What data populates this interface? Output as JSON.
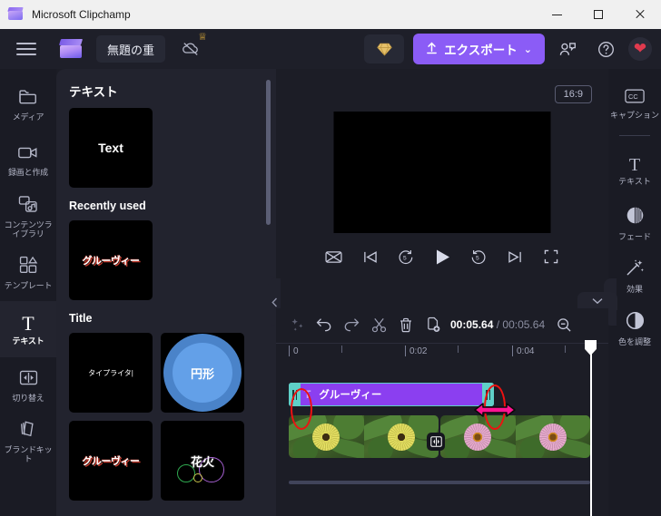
{
  "window": {
    "title": "Microsoft Clipchamp",
    "app_icon": "clapperboard-icon",
    "minimize": "—",
    "maximize": "□",
    "close": "✕"
  },
  "toolbar": {
    "menu_icon": "hamburger-menu-icon",
    "brand_icon": "clipchamp-logo-icon",
    "project_name": "無題の重",
    "cloud_icon": "cloud-off-icon",
    "crown_icon": "♕",
    "gem_icon": "♦",
    "export_label": "エクスポート",
    "export_upload_icon": "upload-arrow-icon",
    "export_caret": "⌄",
    "share_icon": "share-people-icon",
    "help_icon": "question-circle-icon",
    "avatar_icon": "❤"
  },
  "left_rail": {
    "items": [
      {
        "label": "メディア",
        "icon": "folder-icon",
        "active": false
      },
      {
        "label": "録画と作成",
        "icon": "video-camera-icon",
        "active": false
      },
      {
        "label": "コンテンツライブラリ",
        "icon": "content-library-icon",
        "active": false
      },
      {
        "label": "テンプレート",
        "icon": "templates-grid-icon",
        "active": false
      },
      {
        "label": "テキスト",
        "icon": "text-T-icon",
        "active": true
      },
      {
        "label": "切り替え",
        "icon": "transition-icon",
        "active": false
      },
      {
        "label": "ブランドキット",
        "icon": "brand-kit-icon",
        "active": false
      }
    ]
  },
  "library": {
    "heading": "テキスト",
    "sections": [
      {
        "title": "",
        "items": [
          {
            "label": "Text",
            "style": "plain"
          }
        ]
      },
      {
        "title": "Recently used",
        "items": [
          {
            "label": "グルーヴィー",
            "style": "groovy"
          }
        ]
      },
      {
        "title": "Title",
        "items": [
          {
            "label": "タイプライタ",
            "style": "typewriter"
          },
          {
            "label": "円形",
            "style": "circle"
          },
          {
            "label": "グルーヴィー",
            "style": "groovy"
          },
          {
            "label": "花火",
            "style": "fireworks"
          }
        ]
      }
    ],
    "collapse_icon": "chevron-left-icon"
  },
  "right_rail": {
    "items": [
      {
        "label": "キャプション",
        "icon": "closed-caption-icon"
      },
      {
        "label": "テキスト",
        "icon": "text-T-icon"
      },
      {
        "label": "フェード",
        "icon": "fade-icon"
      },
      {
        "label": "効果",
        "icon": "magic-wand-icon"
      },
      {
        "label": "色を調整",
        "icon": "contrast-half-circle-icon"
      }
    ]
  },
  "stage": {
    "aspect_ratio": "16:9",
    "preview_background": "#000000",
    "collapse_left_icon": "chevron-left-icon",
    "collapse_right_icon": "chevron-left-icon",
    "panel_chevron_icon": "chevron-down-icon",
    "controls": [
      {
        "name": "captions-off-button",
        "icon": "⌧"
      },
      {
        "name": "skip-previous-button",
        "icon": "⏮"
      },
      {
        "name": "rewind-5s-button",
        "icon": "↺5"
      },
      {
        "name": "play-button",
        "icon": "▶"
      },
      {
        "name": "forward-5s-button",
        "icon": "↻5"
      },
      {
        "name": "skip-next-button",
        "icon": "⏭"
      },
      {
        "name": "fullscreen-button",
        "icon": "⛶"
      }
    ]
  },
  "timeline": {
    "tools": [
      {
        "name": "auto-compose-button",
        "icon": "sparkle-icon"
      },
      {
        "name": "undo-button",
        "icon": "undo-arrow-icon"
      },
      {
        "name": "redo-button",
        "icon": "redo-arrow-icon"
      },
      {
        "name": "split-button",
        "icon": "scissors-icon"
      },
      {
        "name": "delete-button",
        "icon": "trash-icon"
      },
      {
        "name": "duplicate-button",
        "icon": "duplicate-add-icon"
      }
    ],
    "current_time": "00:05.64",
    "time_separator": "/",
    "total_time": "00:05.64",
    "zoom_out_icon": "magnifier-minus-icon",
    "ruler_labels": [
      "0",
      "0:02",
      "0:04"
    ],
    "text_clip": {
      "icon": "text-T-icon",
      "label": "グルーヴィー",
      "color": "#8b3ff0",
      "selection_color": "#5fd0c8",
      "left_handle": "trim-handle-left",
      "right_handle": "trim-handle-right"
    },
    "video_clips": [
      {
        "name": "video-clip-yellow-flowers"
      },
      {
        "name": "video-clip-pink-flowers"
      }
    ],
    "transition_badge_icon": "transition-icon",
    "playhead": "playhead-marker"
  },
  "annotations": {
    "ellipse_color": "#ee1111",
    "arrow_color": "#ff1493",
    "ellipses": [
      {
        "name": "annotation-ellipse-left-handle"
      },
      {
        "name": "annotation-ellipse-right-handle"
      }
    ],
    "arrow": {
      "name": "annotation-resize-arrow",
      "icon": "double-headed-arrow-icon"
    }
  }
}
